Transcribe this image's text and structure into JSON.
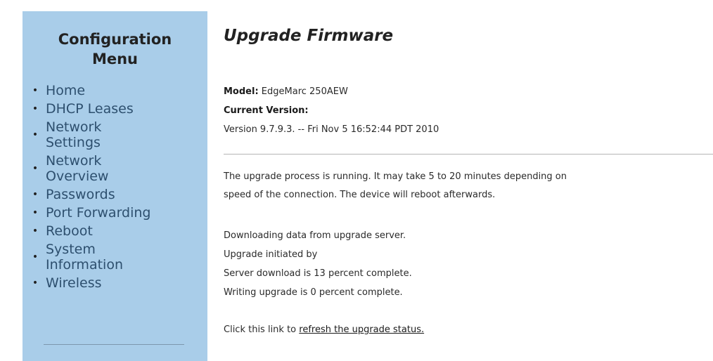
{
  "sidebar": {
    "title": "Configuration Menu",
    "items": [
      {
        "label": "Home"
      },
      {
        "label": "DHCP Leases"
      },
      {
        "label": "Network Settings"
      },
      {
        "label": "Network Overview"
      },
      {
        "label": "Passwords"
      },
      {
        "label": "Port Forwarding"
      },
      {
        "label": "Reboot"
      },
      {
        "label": "System Information"
      },
      {
        "label": "Wireless"
      }
    ]
  },
  "main": {
    "title": "Upgrade Firmware",
    "model_label": "Model:",
    "model_value": "EdgeMarc 250AEW",
    "current_version_label": "Current Version:",
    "version_text": "Version 9.7.9.3.  -- Fri Nov 5 16:52:44 PDT 2010",
    "progress_line1": "The upgrade process is running. It may take 5 to 20 minutes depending on",
    "progress_line2": "speed of the connection. The device will reboot afterwards.",
    "status_download": "Downloading data from upgrade server.",
    "status_initiated": "Upgrade initiated by",
    "status_server": "Server download is 13 percent complete.",
    "status_writing": "Writing upgrade is 0 percent complete.",
    "refresh_prefix": "Click this link to ",
    "refresh_link": "refresh the upgrade status."
  },
  "colors": {
    "sidebar_bg": "#a9cde9",
    "menu_link": "#2d4f6e"
  }
}
